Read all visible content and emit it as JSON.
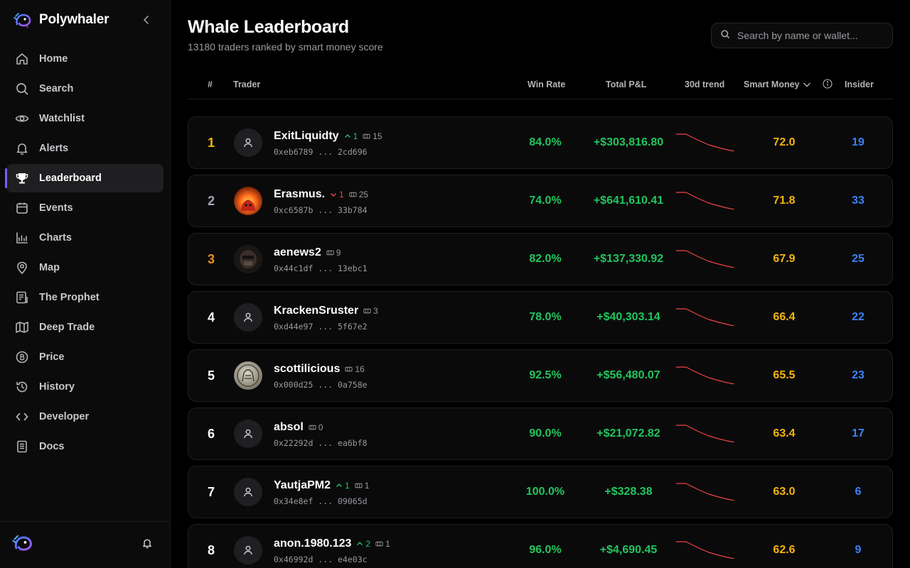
{
  "brand": {
    "name": "Polywhaler",
    "logo_icon": "whale-logo-icon",
    "accent": "#7c5cff"
  },
  "sidebar": {
    "items": [
      {
        "label": "Home",
        "icon": "home-icon"
      },
      {
        "label": "Search",
        "icon": "search-icon"
      },
      {
        "label": "Watchlist",
        "icon": "eye-icon"
      },
      {
        "label": "Alerts",
        "icon": "bell-icon"
      },
      {
        "label": "Leaderboard",
        "icon": "trophy-icon",
        "active": true
      },
      {
        "label": "Events",
        "icon": "calendar-icon"
      },
      {
        "label": "Charts",
        "icon": "chart-icon"
      },
      {
        "label": "Map",
        "icon": "map-pin-icon"
      },
      {
        "label": "The Prophet",
        "icon": "document-icon"
      },
      {
        "label": "Deep Trade",
        "icon": "map-fold-icon"
      },
      {
        "label": "Price",
        "icon": "bitcoin-icon"
      },
      {
        "label": "History",
        "icon": "history-icon"
      },
      {
        "label": "Developer",
        "icon": "code-icon"
      },
      {
        "label": "Docs",
        "icon": "docs-icon"
      }
    ]
  },
  "header": {
    "title": "Whale Leaderboard",
    "subtitle": "13180 traders ranked by smart money score",
    "search_placeholder": "Search by name or wallet..."
  },
  "table": {
    "columns": {
      "rank": "#",
      "trader": "Trader",
      "win_rate": "Win Rate",
      "pnl": "Total P&L",
      "trend": "30d trend",
      "smart_money": "Smart Money",
      "insider": "Insider"
    },
    "colors": {
      "positive": "#22c55e",
      "negative": "#ef4444",
      "score": "#f5b50a",
      "insider": "#3b82f6",
      "trend": "#ef4444"
    },
    "rows": [
      {
        "rank": "1",
        "name": "ExitLiquidty",
        "change": {
          "dir": "up",
          "value": "1"
        },
        "trades": "15",
        "address": "0xeb6789 ... 2cd696",
        "win_rate": "84.0%",
        "pnl": "+$303,816.80",
        "score": "72.0",
        "insider": "19",
        "avatar": "user-icon",
        "rank_style": "gold"
      },
      {
        "rank": "2",
        "name": "Erasmus.",
        "change": {
          "dir": "down",
          "value": "1"
        },
        "trades": "25",
        "address": "0xc6587b ... 33b784",
        "win_rate": "74.0%",
        "pnl": "+$641,610.41",
        "score": "71.8",
        "insider": "33",
        "avatar": "fire-avatar",
        "rank_style": "silver"
      },
      {
        "rank": "3",
        "name": "aenews2",
        "change": null,
        "trades": "9",
        "address": "0x44c1df ... 13ebc1",
        "win_rate": "82.0%",
        "pnl": "+$137,330.92",
        "score": "67.9",
        "insider": "25",
        "avatar": "dark-avatar",
        "rank_style": "bronze"
      },
      {
        "rank": "4",
        "name": "KrackenSruster",
        "change": null,
        "trades": "3",
        "address": "0xd44e97 ... 5f67e2",
        "win_rate": "78.0%",
        "pnl": "+$40,303.14",
        "score": "66.4",
        "insider": "22",
        "avatar": "user-icon",
        "rank_style": "plain"
      },
      {
        "rank": "5",
        "name": "scottilicious",
        "change": null,
        "trades": "16",
        "address": "0x000d25 ... 0a758e",
        "win_rate": "92.5%",
        "pnl": "+$56,480.07",
        "score": "65.5",
        "insider": "23",
        "avatar": "coin-avatar",
        "rank_style": "plain"
      },
      {
        "rank": "6",
        "name": "absol",
        "change": null,
        "trades": "0",
        "address": "0x22292d ... ea6bf8",
        "win_rate": "90.0%",
        "pnl": "+$21,072.82",
        "score": "63.4",
        "insider": "17",
        "avatar": "user-icon",
        "rank_style": "plain"
      },
      {
        "rank": "7",
        "name": "YautjaPM2",
        "change": {
          "dir": "up",
          "value": "1"
        },
        "trades": "1",
        "address": "0x34e8ef ... 09065d",
        "win_rate": "100.0%",
        "pnl": "+$328.38",
        "score": "63.0",
        "insider": "6",
        "avatar": "user-icon",
        "rank_style": "plain"
      },
      {
        "rank": "8",
        "name": "anon.1980.123",
        "change": {
          "dir": "up",
          "value": "2"
        },
        "trades": "1",
        "address": "0x46992d ... e4e03c",
        "win_rate": "96.0%",
        "pnl": "+$4,690.45",
        "score": "62.6",
        "insider": "9",
        "avatar": "user-icon",
        "rank_style": "plain"
      }
    ]
  }
}
